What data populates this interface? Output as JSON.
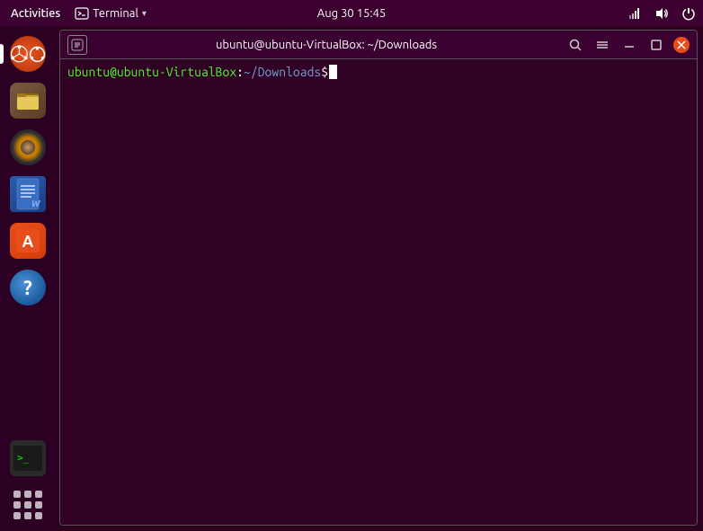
{
  "topbar": {
    "activities_label": "Activities",
    "terminal_menu_label": "Terminal",
    "datetime": "Aug 30  15:45"
  },
  "terminal": {
    "title": "ubuntu@ubuntu-VirtualBox: ~/Downloads",
    "prompt_user_host": "ubuntu@ubuntu-VirtualBox",
    "prompt_dir": "~/Downloads",
    "prompt_symbol": "$"
  },
  "dock": {
    "items": [
      {
        "name": "ubuntu-logo",
        "label": "Ubuntu"
      },
      {
        "name": "files",
        "label": "Files"
      },
      {
        "name": "rhythmbox",
        "label": "Rhythmbox"
      },
      {
        "name": "writer",
        "label": "LibreOffice Writer"
      },
      {
        "name": "appstore",
        "label": "Ubuntu Software"
      },
      {
        "name": "help",
        "label": "Help"
      },
      {
        "name": "terminal",
        "label": "Terminal"
      }
    ]
  },
  "titlebar": {
    "new_tab_icon": "+",
    "search_icon": "🔍",
    "menu_icon": "≡",
    "minimize_icon": "─",
    "maximize_icon": "□",
    "close_icon": "✕"
  }
}
